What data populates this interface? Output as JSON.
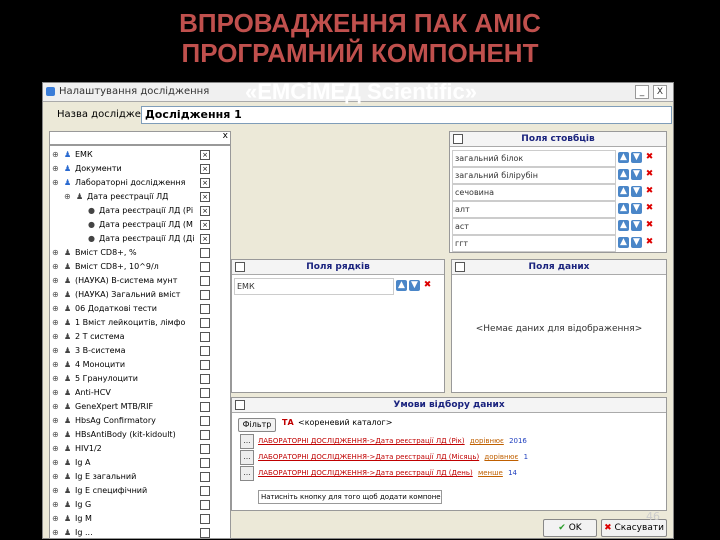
{
  "slide": {
    "title_line1": "ВПРОВАДЖЕННЯ ПАК АМІС",
    "title_line2": "ПРОГРАМНИЙ КОМПОНЕНТ",
    "subtitle": "«ЕМСіМЕД Scientific»",
    "page_number": "46"
  },
  "window": {
    "title": "Налаштування дослідження",
    "minimize": "_",
    "close": "X"
  },
  "form": {
    "name_label": "Назва дослідження",
    "name_value": "Дослідження 1",
    "filter_clear": "x"
  },
  "tree_items": [
    {
      "label": "ЕМК"
    },
    {
      "label": "Документи"
    },
    {
      "label": "Лабораторні дослідження"
    },
    {
      "label": "Дата реєстрації ЛД"
    },
    {
      "label": "Дата реєстрації ЛД (Рі"
    },
    {
      "label": "Дата реєстрації ЛД (М"
    },
    {
      "label": "Дата реєстрації ЛД (Ді"
    },
    {
      "label": "Вміст CD8+, %"
    },
    {
      "label": "Вміст CD8+, 10^9/л"
    },
    {
      "label": "(НАУКА) В-система мунт"
    },
    {
      "label": "(НАУКА) Загальний вміст"
    },
    {
      "label": "06 Додаткові тести"
    },
    {
      "label": "1 Вміст лейкоцитів, лімфо"
    },
    {
      "label": "2 Т система"
    },
    {
      "label": "3 В-система"
    },
    {
      "label": "4 Моноцити"
    },
    {
      "label": "5 Гранулоцити"
    },
    {
      "label": "Anti-HCV"
    },
    {
      "label": "GeneXpert MTB/RIF"
    },
    {
      "label": "HbsAg Confirmatory"
    },
    {
      "label": "HBsAntiBody (kit-kidoult)"
    },
    {
      "label": "HIV1/2"
    },
    {
      "label": "Ig A"
    },
    {
      "label": "Ig E загальний"
    },
    {
      "label": "Ig E специфічний"
    },
    {
      "label": "Ig G"
    },
    {
      "label": "Ig M"
    },
    {
      "label": "Ig ..."
    }
  ],
  "columns_panel": {
    "title": "Поля стовбців",
    "rows": [
      "загальний білок",
      "загальний білірубін",
      "сечовина",
      "алт",
      "аст",
      "ггт"
    ]
  },
  "rows_panel": {
    "title": "Поля рядків",
    "rows": [
      "ЕМК"
    ]
  },
  "data_panel": {
    "title": "Поля даних",
    "empty": "<Немає даних для відображення>"
  },
  "conditions_panel": {
    "title": "Умови відбору даних",
    "filter_button": "Фільтр",
    "root_tag": "ТА",
    "root_label": "<кореневий каталог>",
    "conditions": [
      {
        "path": "ЛАБОРАТОРНІ ДОСЛІДЖЕННЯ->Дата реєстрації ЛД (Рік)",
        "op": "дорівнює",
        "value": "2016"
      },
      {
        "path": "ЛАБОРАТОРНІ ДОСЛІДЖЕННЯ->Дата реєстрації ЛД (Місяць)",
        "op": "дорівнює",
        "value": "1"
      },
      {
        "path": "ЛАБОРАТОРНІ ДОСЛІДЖЕННЯ->Дата реєстрації ЛД (День)",
        "op": "менше",
        "value": "14"
      }
    ],
    "hint": "Натисніть кнопку для того щоб додати компонент"
  },
  "footer": {
    "ok_label": "OK",
    "cancel_label": "Скасувати"
  },
  "colors": {
    "title_red": "#c0504d",
    "link_red": "#c00000",
    "op_orange": "#c06000",
    "value_blue": "#1f3fbf",
    "header_blue": "#1a237e"
  }
}
